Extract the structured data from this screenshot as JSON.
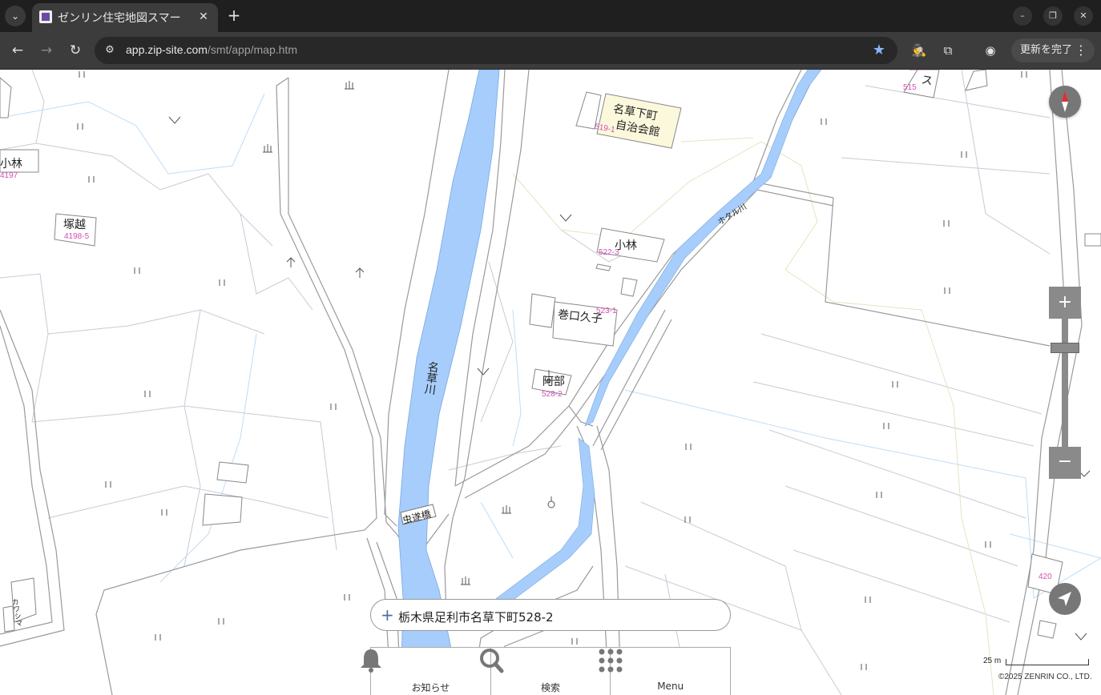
{
  "browser": {
    "tab_title": "ゼンリン住宅地図スマー",
    "url_host": "app.zip-site.com",
    "url_path": "/smt/app/map.htm",
    "update_label": "更新を完了"
  },
  "map": {
    "buildings": [
      {
        "name": "名草下町",
        "lot": "519-1"
      },
      {
        "name": "自治会館"
      },
      {
        "name": "小林",
        "lot": "4197"
      },
      {
        "name": "塚越",
        "lot": "4198-5"
      },
      {
        "name": "小林",
        "lot": "522-3"
      },
      {
        "name": "巻口久子",
        "lot": "523-1"
      },
      {
        "name": "阿部",
        "lot": "528-2"
      },
      {
        "name": "ス",
        "lot": "515"
      },
      {
        "name": "カワシマ"
      }
    ],
    "extra_lot": "420",
    "rivers": {
      "main": "名草川",
      "side": "ホタル川"
    },
    "bridge": "虫遂橋",
    "address": "栃木県足利市名草下町528-2"
  },
  "controls": {
    "zoom_in_label": "+",
    "zoom_out_label": "−"
  },
  "menu": {
    "notice": "お知らせ",
    "search": "検索",
    "menu": "Menu"
  },
  "scale_label": "25 m",
  "copyright": "©2025 ZENRIN CO., LTD."
}
